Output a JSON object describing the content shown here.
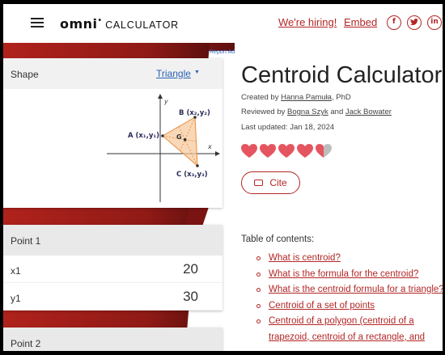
{
  "header": {
    "logo_brand": "omni",
    "logo_product": "CALCULATOR",
    "links": {
      "hiring": "We're hiring!",
      "embed": "Embed"
    },
    "social": {
      "facebook": "f",
      "twitter": "t",
      "linkedin": "in"
    }
  },
  "ad": {
    "report": "Report Ad"
  },
  "calculator": {
    "shape_label": "Shape",
    "shape_value": "Triangle",
    "diagram": {
      "axis_x": "x",
      "axis_y": "y",
      "vertex_a": "A (x₁,y₁)",
      "vertex_b": "B (x₂,y₂)",
      "vertex_c": "C (x₃,y₃)",
      "centroid": "G"
    },
    "point1": {
      "title": "Point 1",
      "x_label": "x1",
      "x_value": "20",
      "y_label": "y1",
      "y_value": "30"
    },
    "point2": {
      "title": "Point 2"
    }
  },
  "article": {
    "title": "Centroid Calculator",
    "created_prefix": "Created by",
    "created_by": "Hanna Pamuła",
    "created_suffix": ", PhD",
    "reviewed_prefix": "Reviewed by",
    "reviewer1": "Bogna Szyk",
    "reviewed_and": "and",
    "reviewer2": "Jack Bowater",
    "updated": "Last updated: Jan 18, 2024",
    "rating_hearts": 4.5,
    "cite_label": "Cite",
    "toc_title": "Table of contents:",
    "toc": [
      "What is centroid?",
      "What is the formula for the centroid?",
      "What is the centroid formula for a triangle?",
      "Centroid of a set of points",
      "Centroid of a polygon (centroid of a",
      "trapezoid, centroid of a rectangle, and"
    ]
  },
  "colors": {
    "accent": "#b32626",
    "link_blue": "#2a61b5",
    "triangle_fill": "#f6c79a"
  }
}
